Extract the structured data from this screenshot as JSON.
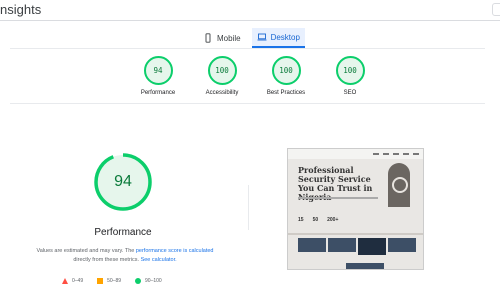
{
  "header": {
    "title": "nsights"
  },
  "tabs": [
    {
      "label": "Mobile",
      "icon": "phone-icon",
      "active": false
    },
    {
      "label": "Desktop",
      "icon": "laptop-icon",
      "active": true
    }
  ],
  "scores": [
    {
      "value": "94",
      "label": "Performance"
    },
    {
      "value": "100",
      "label": "Accessibility"
    },
    {
      "value": "100",
      "label": "Best Practices"
    },
    {
      "value": "100",
      "label": "SEO"
    }
  ],
  "performance": {
    "score": "94",
    "score_fraction": 0.94,
    "title": "Performance",
    "note_prefix": "Values are estimated and may vary. The ",
    "note_link1": "performance score is calculated",
    "note_middle": " directly from these metrics. ",
    "note_link2": "See calculator."
  },
  "legend": [
    {
      "range": "0–49",
      "color": "#ff4e42"
    },
    {
      "range": "50–89",
      "color": "#ffa400"
    },
    {
      "range": "90–100",
      "color": "#0cce6b"
    }
  ],
  "screenshot_preview": {
    "heading": "Professional Security Service You Can Trust in Nigeria",
    "stats": [
      "15",
      "50",
      "200+"
    ]
  },
  "colors": {
    "good": "#0cce6b",
    "accent": "#1a73e8"
  }
}
